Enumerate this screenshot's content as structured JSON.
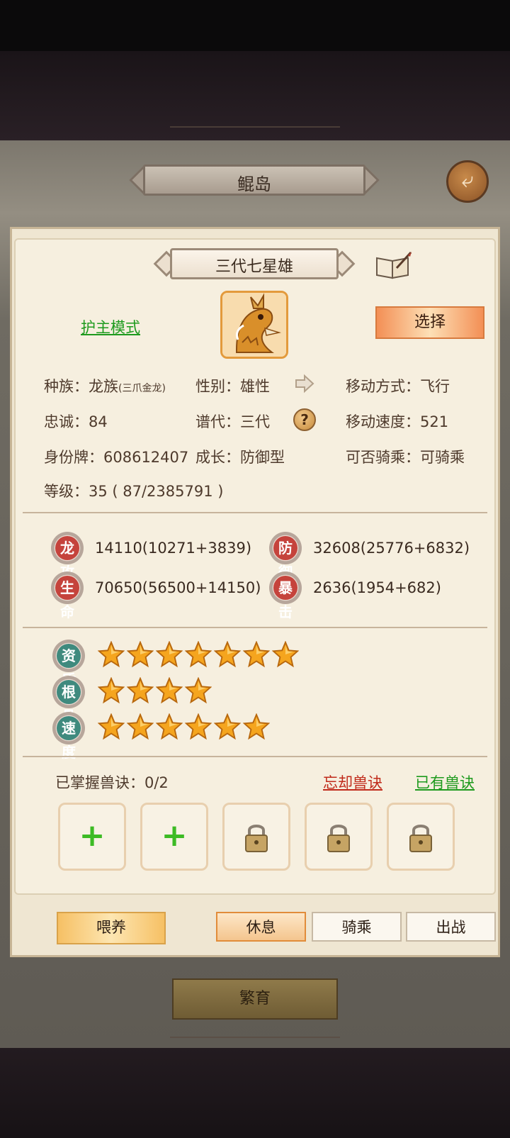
{
  "header": {
    "title": "鲲岛"
  },
  "pet": {
    "name": "三代七星雄",
    "mode_link": "护主模式",
    "select_label": "选择",
    "race_label": "种族：",
    "race_value": "龙族",
    "race_sub": "(三爪金龙)",
    "gender_label": "性别：",
    "gender_value": "雄性",
    "move_type_label": "移动方式：",
    "move_type_value": "飞行",
    "loyalty_label": "忠诚：",
    "loyalty_value": "84",
    "generation_label": "谱代：",
    "generation_value": "三代",
    "move_speed_label": "移动速度：",
    "move_speed_value": "521",
    "id_label": "身份牌：",
    "id_value": "608612407",
    "growth_label": "成长：",
    "growth_value": "防御型",
    "rideable_label": "可否骑乘：",
    "rideable_value": "可骑乘",
    "level_label": "等级：",
    "level_value": "35 ( 87/2385791 )"
  },
  "stats": [
    {
      "badge": "龙攻",
      "value": "14110(10271+3839)"
    },
    {
      "badge": "防御",
      "value": "32608(25776+6832)"
    },
    {
      "badge": "生命",
      "value": "70650(56500+14150)"
    },
    {
      "badge": "暴击",
      "value": "2636(1954+682)"
    }
  ],
  "ratings": [
    {
      "badge": "资质",
      "stars": 7
    },
    {
      "badge": "根骨",
      "stars": 4
    },
    {
      "badge": "速度",
      "stars": 6
    }
  ],
  "skills": {
    "mastered_label": "已掌握兽诀：",
    "mastered_value": "0/2",
    "forget_link": "忘却兽诀",
    "owned_link": "已有兽诀",
    "slots": [
      "add",
      "add",
      "locked",
      "locked",
      "locked"
    ]
  },
  "actions": {
    "feed": "喂养",
    "rest": "休息",
    "ride": "骑乘",
    "battle": "出战",
    "active_tab": "rest"
  },
  "footer": {
    "breed": "繁育"
  },
  "icons": [
    "back-arrow-icon",
    "book-quill-icon",
    "dragon-portrait-icon",
    "arrow-right-icon",
    "question-icon",
    "star-icon",
    "plus-icon",
    "lock-icon"
  ],
  "colors": {
    "accent_orange": "#f38f55",
    "link_green": "#1d9a1d",
    "link_red": "#c02a1a",
    "badge_red": "#c5433c",
    "badge_teal": "#3f8a7e"
  }
}
